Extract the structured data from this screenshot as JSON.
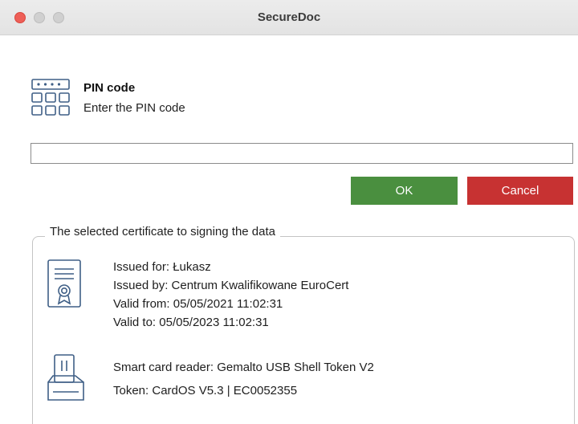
{
  "window": {
    "title": "SecureDoc"
  },
  "pin": {
    "icon": "keypad-icon",
    "title": "PIN code",
    "subtitle": "Enter the PIN code",
    "input_value": "",
    "input_placeholder": ""
  },
  "buttons": {
    "ok_label": "OK",
    "cancel_label": "Cancel"
  },
  "certificate": {
    "legend": "The selected certificate to signing the data",
    "icon": "certificate-icon",
    "issued_for": "Issued for: Łukasz",
    "issued_by": "Issued by: Centrum Kwalifikowane EuroCert",
    "valid_from": "Valid from: 05/05/2021 11:02:31",
    "valid_to": "Valid to: 05/05/2023 11:02:31"
  },
  "reader": {
    "icon": "card-reader-icon",
    "reader_name": "Smart card reader: Gemalto USB Shell Token V2",
    "token": "Token: CardOS V5.3 | EC0052355"
  },
  "colors": {
    "ok": "#4a8f3f",
    "cancel": "#c73232",
    "icon_blue": "#3f5f86"
  }
}
